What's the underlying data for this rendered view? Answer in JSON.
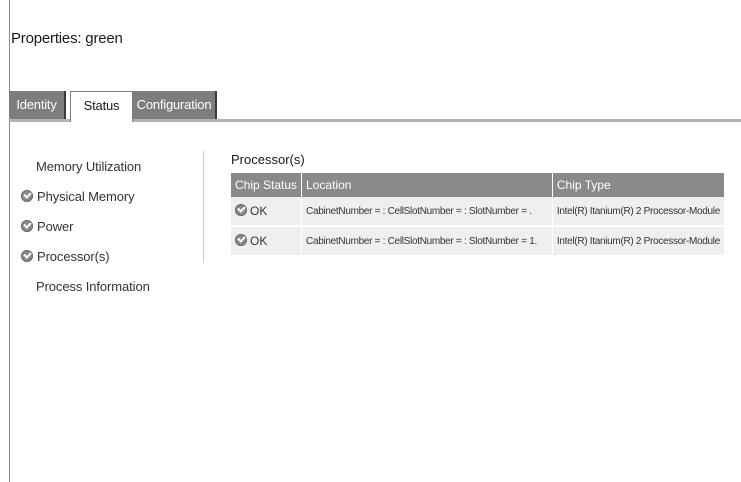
{
  "page": {
    "title": "Properties: green"
  },
  "tabs": [
    {
      "label": "Identity",
      "active": false
    },
    {
      "label": "Status",
      "active": true
    },
    {
      "label": "Configuration",
      "active": false
    }
  ],
  "sidebar": {
    "items": [
      {
        "label": "Memory Utilization",
        "icon": null
      },
      {
        "label": "Physical Memory",
        "icon": "check-circle-icon"
      },
      {
        "label": "Power",
        "icon": "check-circle-icon"
      },
      {
        "label": "Processor(s)",
        "icon": "check-circle-icon"
      },
      {
        "label": "Process Information",
        "icon": null
      }
    ]
  },
  "main": {
    "section_title": "Processor(s)",
    "columns": [
      "Chip Status",
      "Location",
      "Chip Type"
    ],
    "rows": [
      {
        "status": "OK",
        "location": "CabinetNumber =  : CellSlotNumber =  : SlotNumber = .",
        "chip_type": "Intel(R) Itanium(R) 2 Processor-Module"
      },
      {
        "status": "OK",
        "location": "CabinetNumber =  : CellSlotNumber =  : SlotNumber = 1.",
        "chip_type": "Intel(R) Itanium(R) 2 Processor-Module"
      }
    ]
  },
  "colors": {
    "tab_inactive": "#7d7d7d",
    "table_header": "#8a8a8a",
    "table_row": "#efefef",
    "status_icon": "#8a8a8a"
  }
}
